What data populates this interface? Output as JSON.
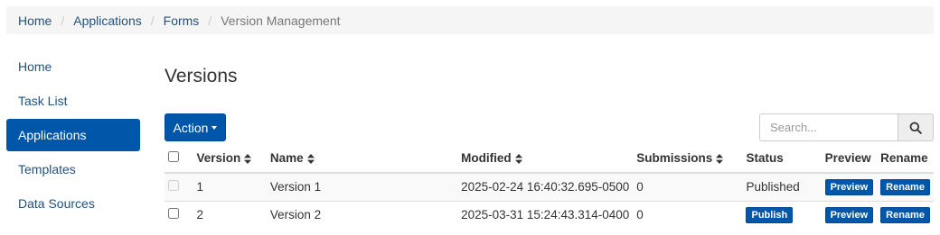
{
  "breadcrumb": {
    "items": [
      {
        "label": "Home"
      },
      {
        "label": "Applications"
      },
      {
        "label": "Forms"
      }
    ],
    "current": "Version Management",
    "separator": "/"
  },
  "sidebar": {
    "items": [
      {
        "label": "Home",
        "active": false
      },
      {
        "label": "Task List",
        "active": false
      },
      {
        "label": "Applications",
        "active": true
      },
      {
        "label": "Templates",
        "active": false
      },
      {
        "label": "Data Sources",
        "active": false
      }
    ]
  },
  "page": {
    "title": "Versions",
    "action_label": "Action",
    "search_placeholder": "Search..."
  },
  "table": {
    "headers": {
      "version": "Version",
      "name": "Name",
      "modified": "Modified",
      "submissions": "Submissions",
      "status": "Status",
      "preview": "Preview",
      "rename": "Rename"
    },
    "rows": [
      {
        "version": "1",
        "name": "Version 1",
        "modified": "2025-02-24 16:40:32.695-0500",
        "submissions": "0",
        "status": "Published",
        "preview_label": "Preview",
        "rename_label": "Rename",
        "checkbox_disabled": true
      },
      {
        "version": "2",
        "name": "Version 2",
        "modified": "2025-03-31 15:24:43.314-0400",
        "submissions": "0",
        "publish_label": "Publish",
        "preview_label": "Preview",
        "rename_label": "Rename",
        "checkbox_disabled": false
      }
    ]
  },
  "colors": {
    "primary": "#0056a8",
    "link": "#23527c",
    "breadcrumb_bg": "#f5f5f5"
  }
}
